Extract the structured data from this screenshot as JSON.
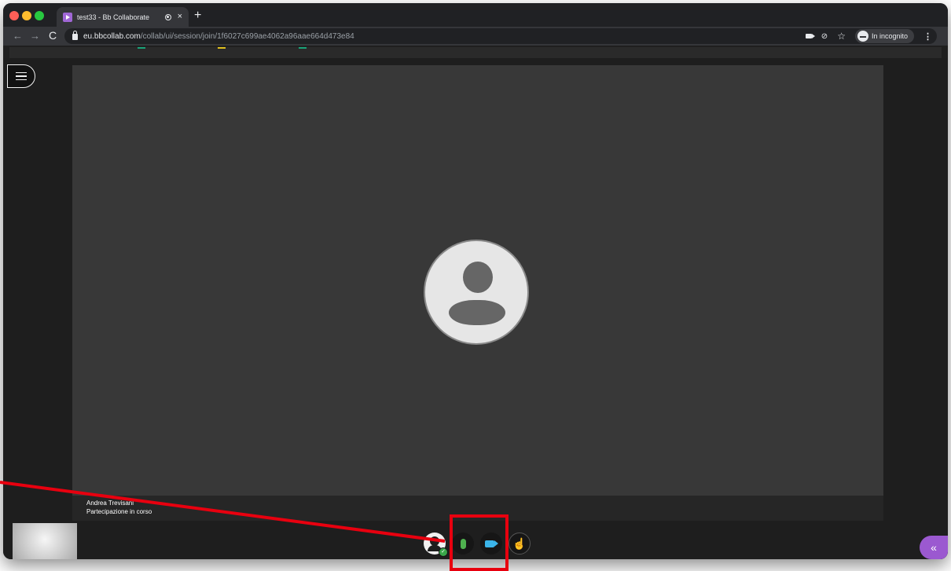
{
  "browser": {
    "tab": {
      "title": "test33 - Bb Collaborate",
      "close_glyph": "×"
    },
    "new_tab_glyph": "+",
    "nav": {
      "back": "←",
      "forward": "→",
      "reload": "C"
    },
    "url": {
      "host": "eu.bbcollab.com",
      "path": "/collab/ui/session/join/1f6027c699ae4062a96aae664d473e84"
    },
    "incognito_label": "In incognito",
    "star_glyph": "☆",
    "menu_glyph": "⋮",
    "eye_glyph": "⊘"
  },
  "session": {
    "participant_name": "Andrea Trevisani",
    "participant_status": "Partecipazione in corso",
    "status_check_glyph": "✓",
    "hand_glyph": "☝",
    "panel_toggle_glyph": "«"
  },
  "icons": {
    "menu": "hamburger-icon",
    "avatar": "person-icon",
    "mic": "microphone-icon",
    "camera": "camera-icon",
    "raise_hand": "raise-hand-icon",
    "collapse": "chevrons-left-icon"
  },
  "colors": {
    "mic_active": "#4fb14f",
    "camera_active": "#3bb5ea",
    "panel_accent": "#9b59d0",
    "annotation": "#e8000f",
    "favicon": "#a067d6",
    "bookmark_marks": [
      "#1aa37a",
      "#e0c020",
      "#1aa37a"
    ]
  }
}
